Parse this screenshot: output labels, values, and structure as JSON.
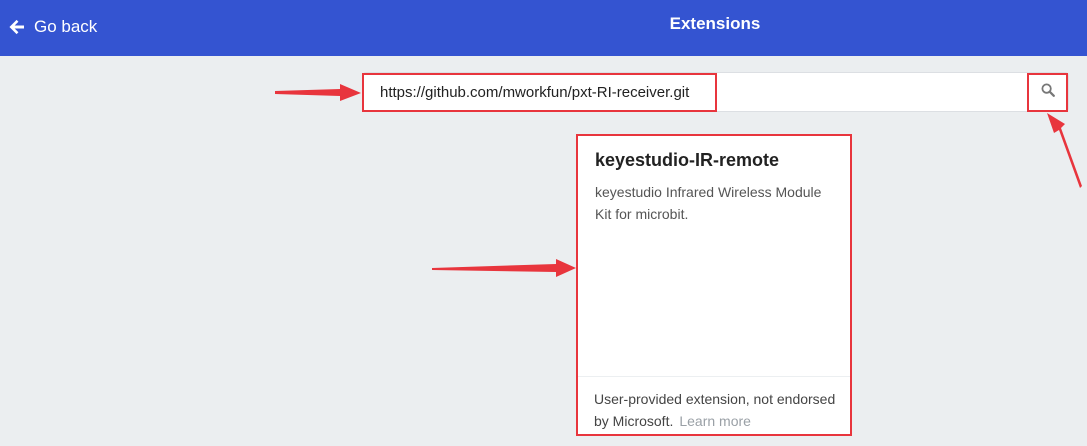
{
  "header": {
    "back_label": "Go back",
    "title": "Extensions",
    "background_color": "#3454d1"
  },
  "search": {
    "value": "https://github.com/mworkfun/pxt-RI-receiver.git",
    "button_icon": "search-icon"
  },
  "result_card": {
    "title": "keyestudio-IR-remote",
    "description": "keyestudio Infrared Wireless Module Kit for microbit.",
    "footer_text": "User-provided extension, not endorsed by Microsoft.",
    "learn_more_label": "Learn more"
  },
  "annotation_color": "#e8353d"
}
